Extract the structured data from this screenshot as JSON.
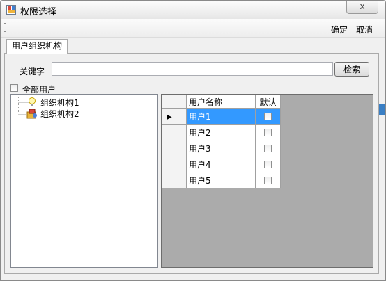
{
  "window": {
    "title": "权限选择",
    "close_glyph": "x"
  },
  "toolbar": {
    "ok_label": "确定",
    "cancel_label": "取消"
  },
  "tabs": [
    {
      "label": "用户组织机构"
    }
  ],
  "search": {
    "label": "关键字",
    "value": "",
    "button_label": "检索"
  },
  "all_users": {
    "label": "全部用户",
    "checked": false
  },
  "tree": {
    "nodes": [
      {
        "label": "组织机构1",
        "icon": "lightbulb-icon"
      },
      {
        "label": "组织机构2",
        "icon": "org-folder-icon"
      }
    ]
  },
  "grid": {
    "columns": {
      "name": "用户名称",
      "default": "默认"
    },
    "rows": [
      {
        "name": "用户1",
        "default": false,
        "selected": true
      },
      {
        "name": "用户2",
        "default": false
      },
      {
        "name": "用户3",
        "default": false
      },
      {
        "name": "用户4",
        "default": false
      },
      {
        "name": "用户5",
        "default": false
      }
    ]
  },
  "colors": {
    "selection": "#3399ff",
    "grid_background": "#ababab"
  }
}
